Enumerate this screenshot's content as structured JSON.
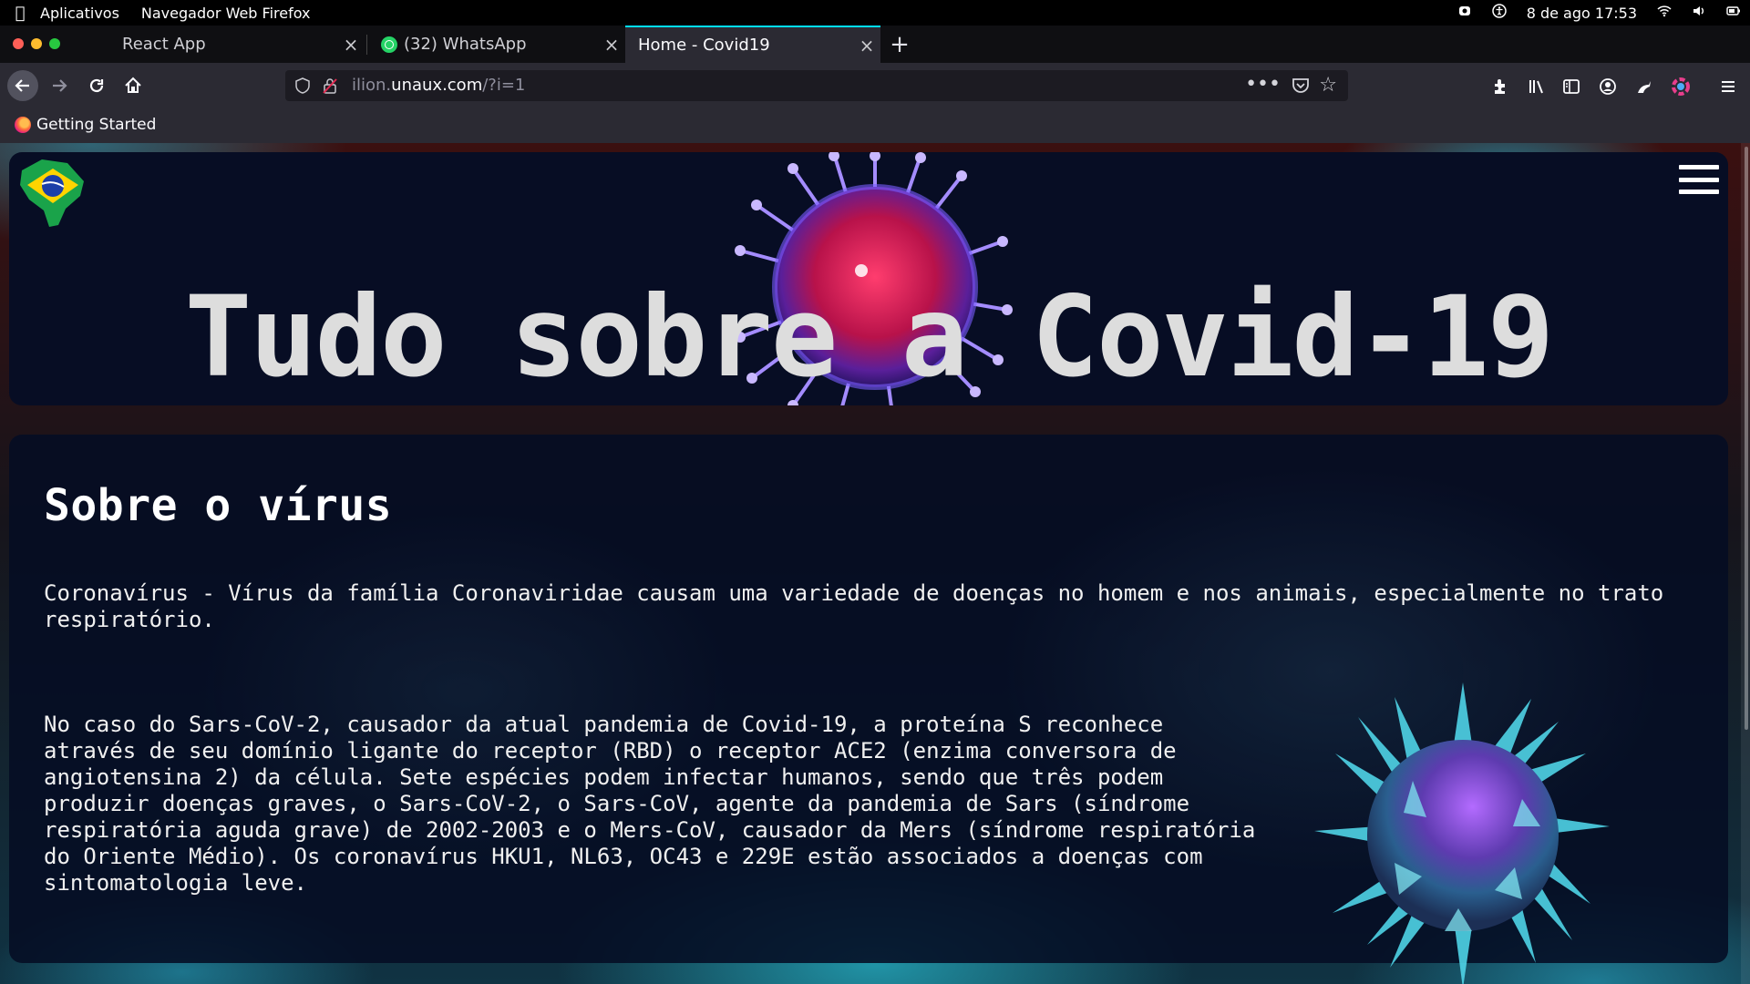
{
  "os_bar": {
    "menu_apps": "Aplicativos",
    "menu_app": "Navegador Web Firefox",
    "clock": "8 de ago 17:53"
  },
  "tabs": [
    {
      "label": "React App",
      "active": false
    },
    {
      "label": "(32) WhatsApp",
      "active": false
    },
    {
      "label": "Home - Covid19",
      "active": true
    }
  ],
  "address_bar": {
    "url_prefix": "ilion.",
    "url_domain": "unaux.com",
    "url_suffix": "/?i=1"
  },
  "bookmarks": [
    {
      "label": "Getting Started"
    }
  ],
  "hero": {
    "title": "Tudo sobre a Covid-19"
  },
  "section": {
    "heading": "Sobre o vírus",
    "paragraph1": "Coronavírus - Vírus da família Coronaviridae causam uma variedade de doenças no homem e nos animais, especialmente no trato respiratório.",
    "paragraph2": "No caso do Sars-CoV-2, causador da atual pandemia de Covid-19, a proteína S reconhece através de seu domínio ligante do receptor (RBD) o receptor ACE2 (enzima conversora de angiotensina 2) da célula. Sete espécies podem infectar humanos, sendo que três podem produzir doenças graves, o Sars-CoV-2, o Sars-CoV, agente da pandemia de Sars (síndrome respiratória aguda grave) de 2002-2003 e o Mers-CoV, causador da Mers (síndrome respiratória do Oriente Médio). Os coronavírus HKU1, NL63, OC43 e 229E estão associados a doenças com sintomatologia leve."
  },
  "colors": {
    "tab_active_accent": "#00ddff",
    "toolbar": "#2b2a33",
    "hero_bg": "#070d24",
    "title_text": "#dddddd"
  }
}
